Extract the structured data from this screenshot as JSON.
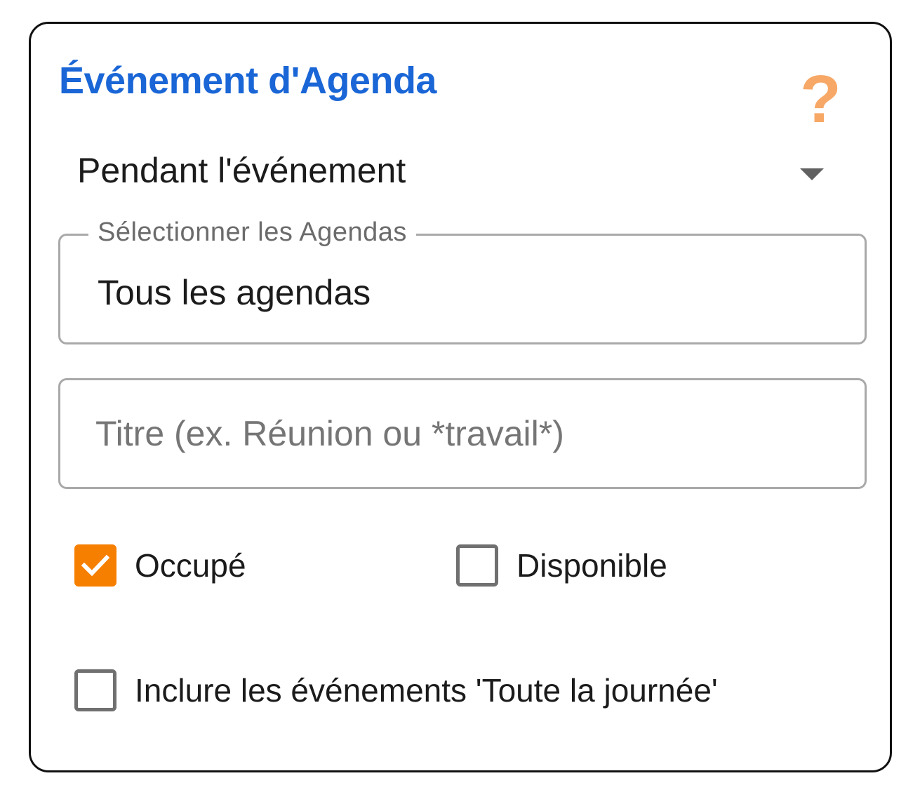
{
  "card": {
    "title": "Événement d'Agenda",
    "help_glyph": "?"
  },
  "event_timing": {
    "selected": "Pendant l'événement",
    "icon": "chevron-down-icon"
  },
  "calendars_field": {
    "label": "Sélectionner les Agendas",
    "value": "Tous les agendas"
  },
  "title_field": {
    "value": "",
    "placeholder": "Titre (ex. Réunion ou *travail*)"
  },
  "availability": {
    "busy": {
      "label": "Occupé",
      "checked": true
    },
    "free": {
      "label": "Disponible",
      "checked": false
    }
  },
  "all_day": {
    "label": "Inclure les événements 'Toute la journée'",
    "checked": false
  },
  "colors": {
    "title": "#1a66d6",
    "help": "#f7a866",
    "checked": "#f77f00"
  }
}
